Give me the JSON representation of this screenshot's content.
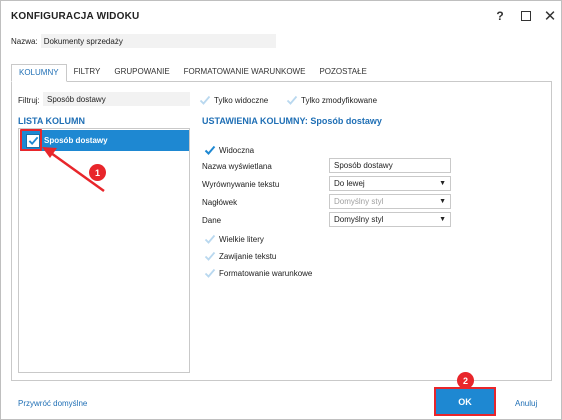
{
  "window": {
    "title": "KONFIGURACJA WIDOKU",
    "help_label": "?",
    "close_label": "✕"
  },
  "name_field": {
    "label": "Nazwa:",
    "value": "Dokumenty sprzedaży"
  },
  "tabs": [
    {
      "label": "KOLUMNY",
      "active": true
    },
    {
      "label": "FILTRY",
      "active": false
    },
    {
      "label": "GRUPOWANIE",
      "active": false
    },
    {
      "label": "FORMATOWANIE WARUNKOWE",
      "active": false
    },
    {
      "label": "POZOSTAŁE",
      "active": false
    }
  ],
  "filter": {
    "label": "Filtruj:",
    "value": "Sposób dostawy",
    "only_visible_label": "Tylko widoczne",
    "only_modified_label": "Tylko zmodyfikowane"
  },
  "column_list": {
    "heading": "LISTA KOLUMN",
    "items": [
      {
        "label": "Sposób dostawy",
        "checked": true,
        "selected": true
      }
    ]
  },
  "column_settings": {
    "heading": "USTAWIENIA KOLUMNY: Sposób dostawy",
    "visible_label": "Widoczna",
    "display_name_label": "Nazwa wyświetlana",
    "display_name_value": "Sposób dostawy",
    "alignment_label": "Wyrównywanie tekstu",
    "alignment_value": "Do lewej",
    "header_label": "Nagłówek",
    "header_value": "Domyślny styl",
    "data_label": "Dane",
    "data_value": "Domyślny styl",
    "uppercase_label": "Wielkie litery",
    "wrap_label": "Zawijanie tekstu",
    "conditional_label": "Formatowanie warunkowe"
  },
  "footer": {
    "reset_label": "Przywróć domyślne",
    "ok_label": "OK",
    "cancel_label": "Anuluj"
  },
  "annotations": {
    "step1": "1",
    "step2": "2"
  },
  "colors": {
    "accent": "#1e88d2",
    "heading": "#1f6fb5",
    "marker": "#e8262b"
  }
}
